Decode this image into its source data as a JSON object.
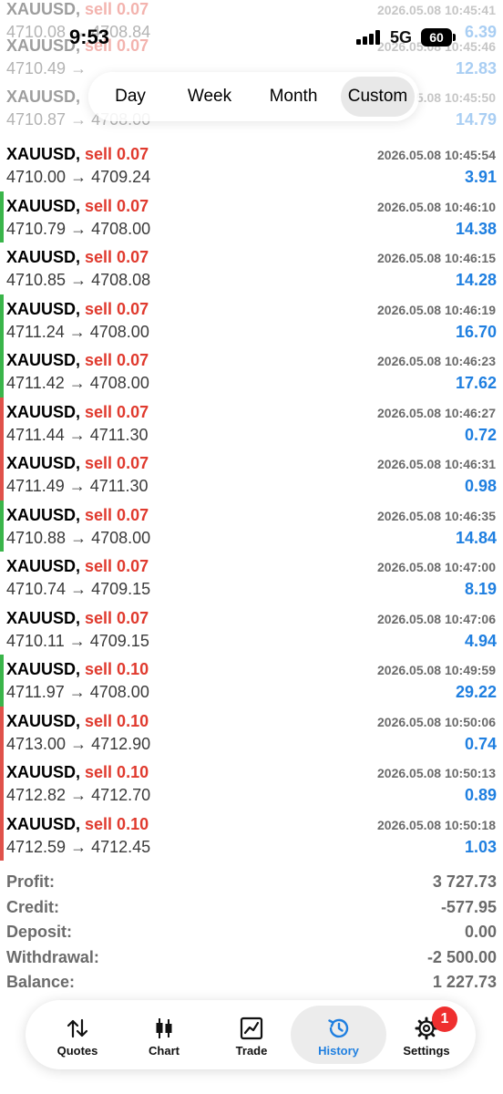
{
  "status_bar": {
    "time": "9:53",
    "network": "5G",
    "battery": "60"
  },
  "period_tabs": [
    "Day",
    "Week",
    "Month",
    "Custom"
  ],
  "period_selected": "Custom",
  "ghost_rows": [
    {
      "symbol": "XAUUSD,",
      "side": "sell 0.07",
      "open": "4710.08",
      "close": "4708.84",
      "time": "2026.05.08 10:45:41",
      "profit": "6.39",
      "bar_color": "#3ab54a"
    },
    {
      "symbol": "XAUUSD,",
      "side": "sell 0.07",
      "open": "4710.49",
      "close": "",
      "time": "2026.05.08 10:45:46",
      "profit": "12.83",
      "bar_color": "#3ab54a"
    },
    {
      "symbol": "XAUUSD,",
      "side": "",
      "open": "4710.87",
      "close": "4708.00",
      "time": "5.08 10:45:50",
      "profit": "14.79",
      "bar_color": "#3ab54a"
    }
  ],
  "trades": [
    {
      "symbol": "XAUUSD,",
      "side": "sell 0.07",
      "open": "4710.00",
      "close": "4709.24",
      "time": "2026.05.08 10:45:54",
      "profit": "3.91",
      "bar_color": ""
    },
    {
      "symbol": "XAUUSD,",
      "side": "sell 0.07",
      "open": "4710.79",
      "close": "4708.00",
      "time": "2026.05.08 10:46:10",
      "profit": "14.38",
      "bar_color": "#3ab54a"
    },
    {
      "symbol": "XAUUSD,",
      "side": "sell 0.07",
      "open": "4710.85",
      "close": "4708.08",
      "time": "2026.05.08 10:46:15",
      "profit": "14.28",
      "bar_color": ""
    },
    {
      "symbol": "XAUUSD,",
      "side": "sell 0.07",
      "open": "4711.24",
      "close": "4708.00",
      "time": "2026.05.08 10:46:19",
      "profit": "16.70",
      "bar_color": "#3ab54a"
    },
    {
      "symbol": "XAUUSD,",
      "side": "sell 0.07",
      "open": "4711.42",
      "close": "4708.00",
      "time": "2026.05.08 10:46:23",
      "profit": "17.62",
      "bar_color": "#3ab54a"
    },
    {
      "symbol": "XAUUSD,",
      "side": "sell 0.07",
      "open": "4711.44",
      "close": "4711.30",
      "time": "2026.05.08 10:46:27",
      "profit": "0.72",
      "bar_color": "#e0524a"
    },
    {
      "symbol": "XAUUSD,",
      "side": "sell 0.07",
      "open": "4711.49",
      "close": "4711.30",
      "time": "2026.05.08 10:46:31",
      "profit": "0.98",
      "bar_color": "#e0524a"
    },
    {
      "symbol": "XAUUSD,",
      "side": "sell 0.07",
      "open": "4710.88",
      "close": "4708.00",
      "time": "2026.05.08 10:46:35",
      "profit": "14.84",
      "bar_color": "#3ab54a"
    },
    {
      "symbol": "XAUUSD,",
      "side": "sell 0.07",
      "open": "4710.74",
      "close": "4709.15",
      "time": "2026.05.08 10:47:00",
      "profit": "8.19",
      "bar_color": ""
    },
    {
      "symbol": "XAUUSD,",
      "side": "sell 0.07",
      "open": "4710.11",
      "close": "4709.15",
      "time": "2026.05.08 10:47:06",
      "profit": "4.94",
      "bar_color": ""
    },
    {
      "symbol": "XAUUSD,",
      "side": "sell 0.10",
      "open": "4711.97",
      "close": "4708.00",
      "time": "2026.05.08 10:49:59",
      "profit": "29.22",
      "bar_color": "#3ab54a"
    },
    {
      "symbol": "XAUUSD,",
      "side": "sell 0.10",
      "open": "4713.00",
      "close": "4712.90",
      "time": "2026.05.08 10:50:06",
      "profit": "0.74",
      "bar_color": "#e0524a"
    },
    {
      "symbol": "XAUUSD,",
      "side": "sell 0.10",
      "open": "4712.82",
      "close": "4712.70",
      "time": "2026.05.08 10:50:13",
      "profit": "0.89",
      "bar_color": "#e0524a"
    },
    {
      "symbol": "XAUUSD,",
      "side": "sell 0.10",
      "open": "4712.59",
      "close": "4712.45",
      "time": "2026.05.08 10:50:18",
      "profit": "1.03",
      "bar_color": "#e0524a"
    }
  ],
  "summary": [
    {
      "label": "Profit:",
      "value": "3 727.73"
    },
    {
      "label": "Credit:",
      "value": "-577.95"
    },
    {
      "label": "Deposit:",
      "value": "0.00"
    },
    {
      "label": "Withdrawal:",
      "value": "-2 500.00"
    },
    {
      "label": "Balance:",
      "value": "1 227.73"
    }
  ],
  "tabs": [
    {
      "label": "Quotes",
      "icon": "up-down-arrows-icon"
    },
    {
      "label": "Chart",
      "icon": "candlestick-icon"
    },
    {
      "label": "Trade",
      "icon": "trade-chart-icon"
    },
    {
      "label": "History",
      "icon": "history-clock-icon"
    },
    {
      "label": "Settings",
      "icon": "gear-icon"
    }
  ],
  "active_tab": "History",
  "settings_badge": "1",
  "colors": {
    "sell": "#e03a2e",
    "profit": "#1f7fe0",
    "win_bar": "#3ab54a",
    "loss_bar": "#e0524a"
  }
}
